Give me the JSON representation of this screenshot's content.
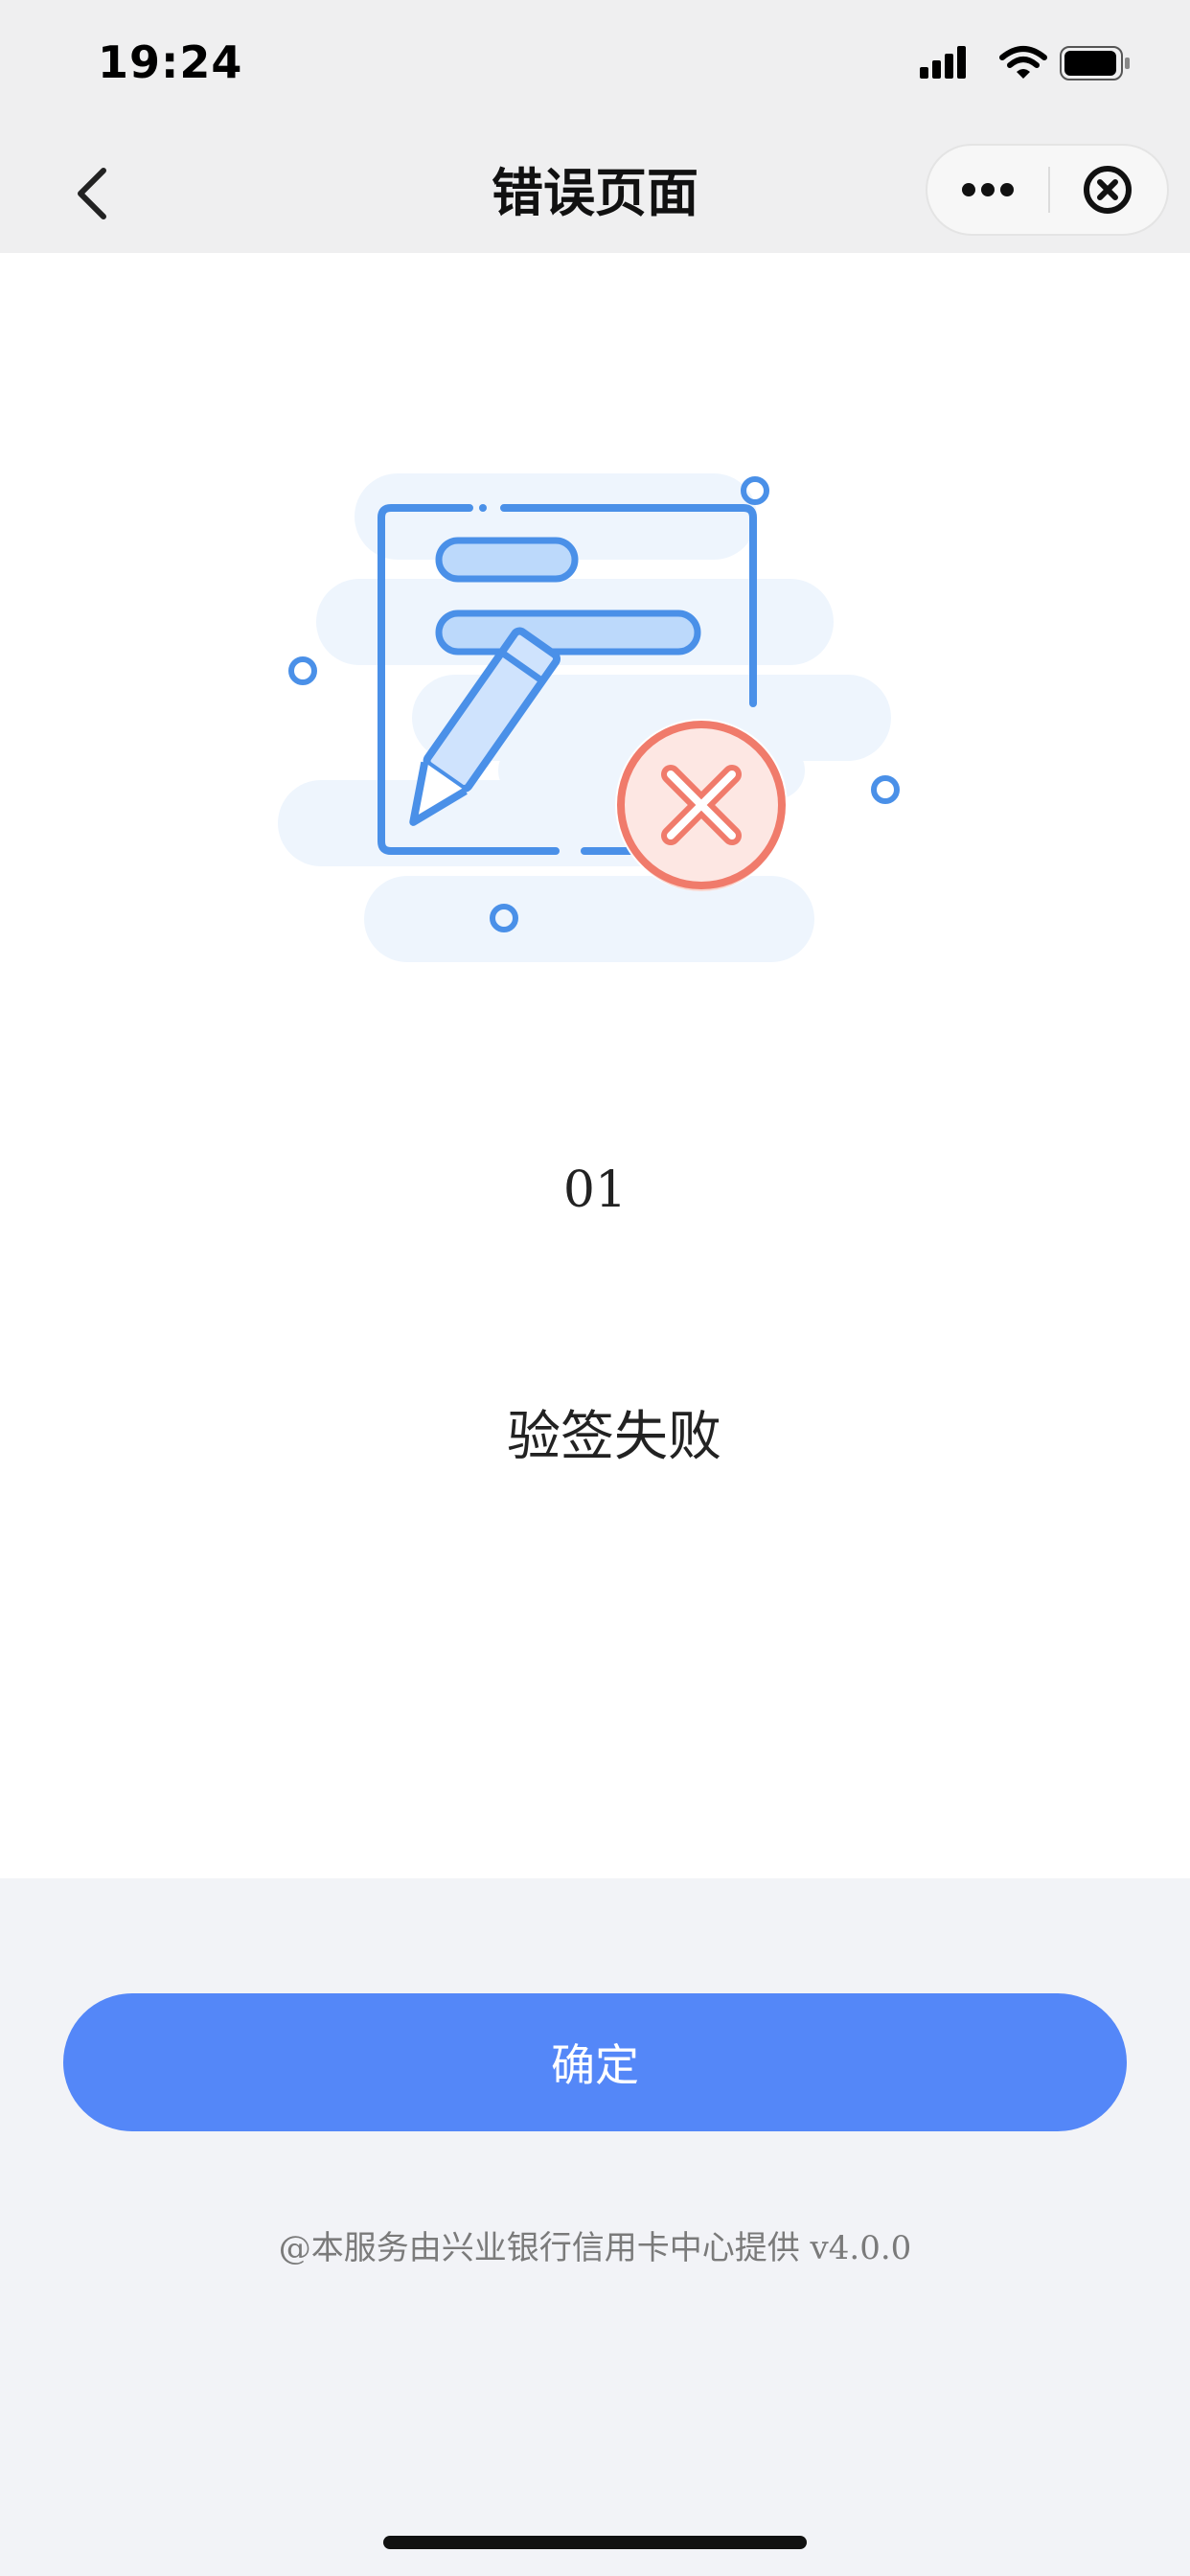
{
  "status_bar": {
    "time": "19:24",
    "icons": [
      "signal-icon",
      "wifi-icon",
      "battery-icon"
    ]
  },
  "nav": {
    "title": "错误页面",
    "back_icon": "chevron-left-icon",
    "more_icon": "more-dots-icon",
    "close_icon": "close-circle-icon"
  },
  "error": {
    "code": "01",
    "message": "验签失败",
    "illustration": "document-error-illustration"
  },
  "actions": {
    "confirm_label": "确定"
  },
  "footer": {
    "text": "@本服务由兴业银行信用卡中心提供 v4.0.0"
  },
  "colors": {
    "accent": "#5487f8",
    "error": "#f07b6b",
    "page_bg": "#f2f3f7"
  }
}
